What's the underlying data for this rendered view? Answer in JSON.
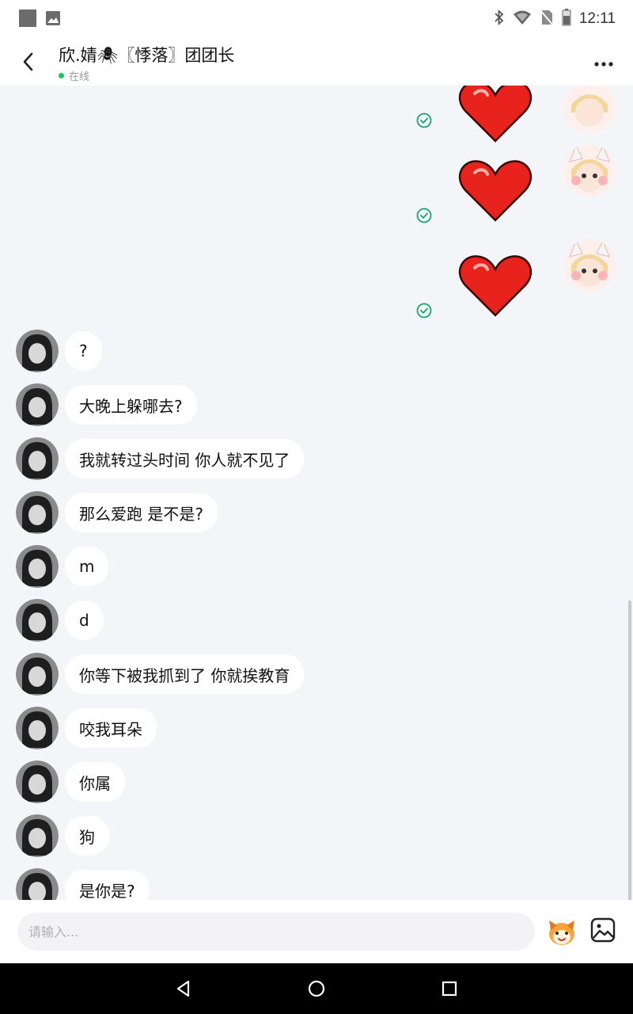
{
  "status_bar": {
    "time": "12:11",
    "icons": [
      "notification-square-icon",
      "image-notification-icon",
      "bluetooth-icon",
      "wifi-icon",
      "no-sim-icon",
      "battery-icon"
    ]
  },
  "header": {
    "title": "欣.婧🕷〖悸落〗团团长",
    "status": "在线",
    "icons": [
      "back-arrow-icon",
      "more-options-icon"
    ]
  },
  "sent_messages": [
    {
      "type": "sticker",
      "sticker": "red-heart",
      "status": "delivered-check-icon"
    },
    {
      "type": "sticker",
      "sticker": "red-heart",
      "status": "delivered-check-icon"
    },
    {
      "type": "sticker",
      "sticker": "red-heart",
      "status": "delivered-check-icon"
    }
  ],
  "received_messages": [
    {
      "text": "?"
    },
    {
      "text": "大晚上躲哪去?"
    },
    {
      "text": "我就转过头时间 你人就不见了"
    },
    {
      "text": "那么爱跑 是不是?"
    },
    {
      "text": "m"
    },
    {
      "text": "d"
    },
    {
      "text": "你等下被我抓到了 你就挨教育"
    },
    {
      "text": "咬我耳朵"
    },
    {
      "text": "你属"
    },
    {
      "text": "狗"
    },
    {
      "text": "是你是?"
    }
  ],
  "input": {
    "placeholder": "请输入..."
  },
  "toolbar_icons": [
    "sticker-icon",
    "image-picker-icon"
  ],
  "nav_bar": [
    "nav-back-icon",
    "nav-home-icon",
    "nav-recents-icon"
  ],
  "colors": {
    "background": "#f4f5f9",
    "online_dot": "#21c45a",
    "check": "#18a46c",
    "heart": "#e8221c",
    "bubble": "#ffffff",
    "nav_bar": "#000000"
  }
}
